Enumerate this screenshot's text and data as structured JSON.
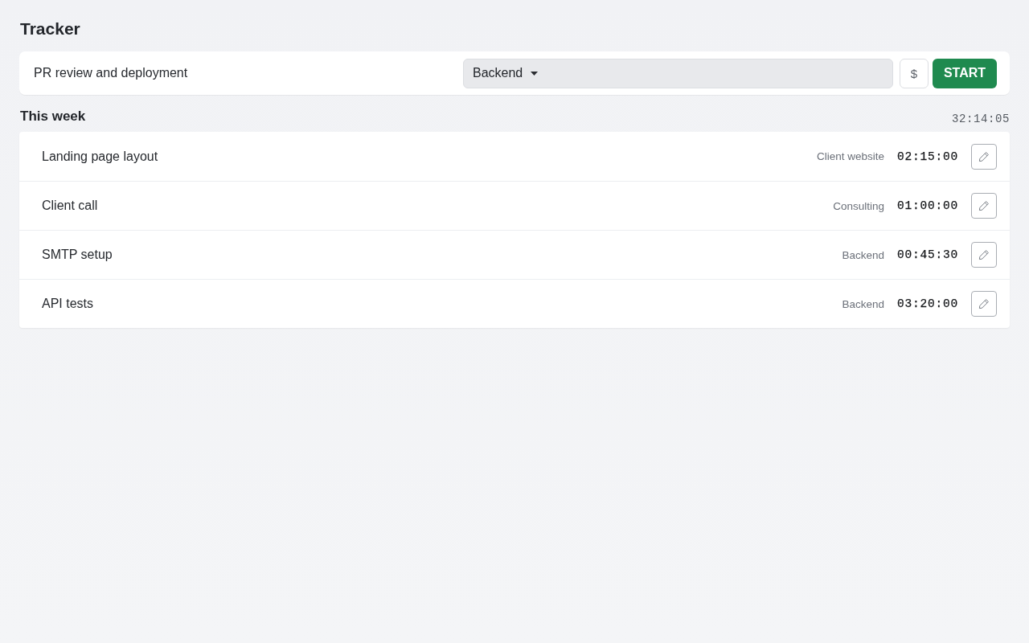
{
  "title": "Tracker",
  "new_entry": {
    "description": {
      "value": "PR review and deployment"
    },
    "project": {
      "value": "Backend"
    },
    "billable_button": {
      "label": "$"
    },
    "start_button": {
      "label": "START"
    }
  },
  "week": {
    "heading": "This week",
    "total": "32:14:05"
  },
  "entries": [
    {
      "description": "Landing page layout",
      "project": "Client website",
      "duration": "02:15:00"
    },
    {
      "description": "Client call",
      "project": "Consulting",
      "duration": "01:00:00"
    },
    {
      "description": "SMTP setup",
      "project": "Backend",
      "duration": "00:45:30"
    },
    {
      "description": "API tests",
      "project": "Backend",
      "duration": "03:20:00"
    }
  ]
}
